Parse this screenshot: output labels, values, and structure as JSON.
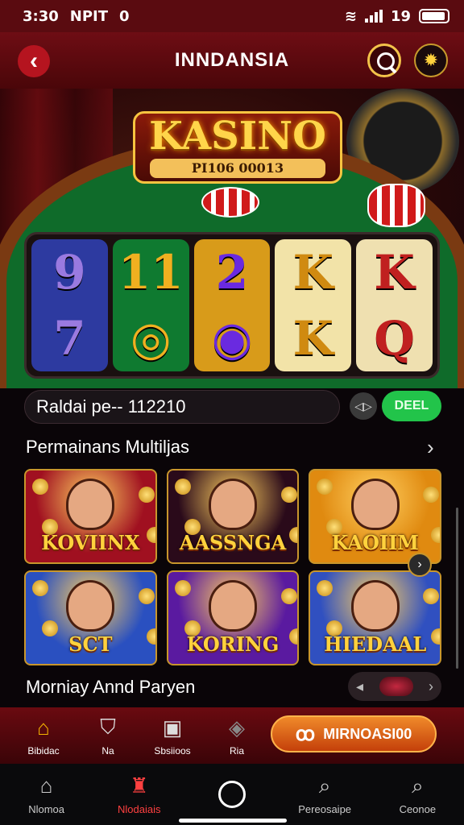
{
  "status": {
    "time": "3:30",
    "carrier": "NPIT",
    "badge": "0",
    "signal_text": "19"
  },
  "header": {
    "title": "INNDANSIA",
    "back_glyph": "‹",
    "settings_glyph": "✹"
  },
  "hero": {
    "logo_title": "KASINO",
    "logo_subtitle": "PI106 00013"
  },
  "reels": [
    {
      "top": "9",
      "bottom": "7",
      "bg": "#2d3aa0",
      "color": "#9a7ae0"
    },
    {
      "top": "11",
      "bottom": "◎",
      "bg": "#0f7a30",
      "color": "#f0b020"
    },
    {
      "top": "2",
      "bottom": "◉",
      "bg": "#d89b1a",
      "color": "#6a2ae0"
    },
    {
      "top": "K",
      "bottom": "K",
      "bg": "#f2e3a8",
      "color": "#d08a10"
    },
    {
      "top": "K",
      "bottom": "Q",
      "bg": "#efe0b0",
      "color": "#c02020"
    }
  ],
  "jackpot": {
    "label": "Raldai pe-- 112210",
    "play_glyph": "◁▷",
    "deal_label": "DEEL"
  },
  "section1": {
    "title": "Permainans Multiljas",
    "arrow": "›"
  },
  "games": [
    {
      "name": "KOVIINX",
      "bg": "#a01020"
    },
    {
      "name": "AASSNGA",
      "bg": "#2a0a1a"
    },
    {
      "name": "KAOIIM",
      "bg": "#e08a10"
    },
    {
      "name": "SCT",
      "bg": "#2a50c0"
    },
    {
      "name": "KORING",
      "bg": "#5a1aa0"
    },
    {
      "name": "HIEDAAL",
      "bg": "#3050c0"
    }
  ],
  "tile_arrow": "›",
  "section2": {
    "title": "Morniay Annd Paryen",
    "pill_left": "◂",
    "pill_right": "›"
  },
  "bottom_nav_top": {
    "items": [
      {
        "icon": "⌂",
        "label": "Bibidac",
        "color": "#f5b400"
      },
      {
        "icon": "⛉",
        "label": "Na",
        "color": "#ddd"
      },
      {
        "icon": "▣",
        "label": "Sbsiioos",
        "color": "#ddd"
      },
      {
        "icon": "◈",
        "label": "Ria",
        "color": "#888"
      }
    ],
    "cta_icon": "ꝏ",
    "cta_label": "MIRNOASI00"
  },
  "bottom_nav": {
    "items": [
      {
        "icon": "⌂",
        "label": "Nlomoa",
        "color": "#ccc"
      },
      {
        "icon": "♜",
        "label": "Nlodaiais",
        "color": "#ff4040"
      },
      {
        "icon": "",
        "label": "",
        "color": "#fff"
      },
      {
        "icon": "⌕",
        "label": "Pereosaipe",
        "color": "#ccc"
      },
      {
        "icon": "⌕",
        "label": "Ceonoe",
        "color": "#ccc"
      }
    ]
  }
}
